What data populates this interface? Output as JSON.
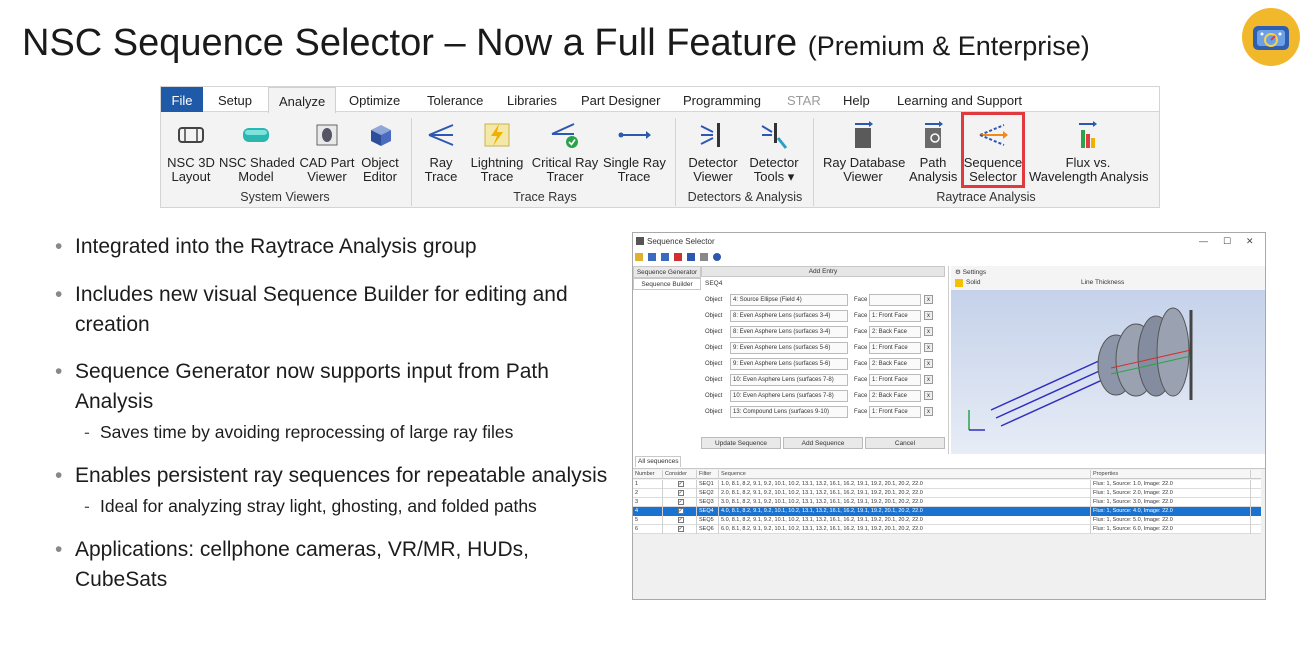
{
  "slide": {
    "title": "NSC Sequence Selector – Now a Full Feature",
    "subtitle": "(Premium & Enterprise)"
  },
  "colors": {
    "file_tab": "#1e5aa8",
    "highlight": "#e0393e",
    "selection": "#1a73d1",
    "logo": "#f2b82c"
  },
  "ribbon": {
    "tabs": [
      "File",
      "Setup",
      "Analyze",
      "Optimize",
      "Tolerance",
      "Libraries",
      "Part Designer",
      "Programming",
      "STAR",
      "Help",
      "Learning and Support"
    ],
    "active_tab": "Analyze",
    "groups": [
      {
        "label": "System Viewers",
        "buttons": [
          {
            "l1": "NSC 3D",
            "l2": "Layout",
            "icon": "nsc-3d-layout-icon"
          },
          {
            "l1": "NSC Shaded",
            "l2": "Model",
            "icon": "shaded-model-icon"
          },
          {
            "l1": "CAD Part",
            "l2": "Viewer",
            "icon": "cad-part-icon"
          },
          {
            "l1": "Object",
            "l2": "Editor",
            "icon": "object-editor-icon"
          }
        ]
      },
      {
        "label": "Trace Rays",
        "buttons": [
          {
            "l1": "Ray",
            "l2": "Trace",
            "icon": "ray-trace-icon"
          },
          {
            "l1": "Lightning",
            "l2": "Trace",
            "icon": "lightning-icon"
          },
          {
            "l1": "Critical Ray",
            "l2": "Tracer",
            "icon": "critical-ray-icon"
          },
          {
            "l1": "Single Ray",
            "l2": "Trace",
            "icon": "single-ray-icon"
          }
        ]
      },
      {
        "label": "Detectors & Analysis",
        "buttons": [
          {
            "l1": "Detector",
            "l2": "Viewer",
            "icon": "detector-viewer-icon"
          },
          {
            "l1": "Detector",
            "l2": "Tools ▾",
            "icon": "detector-tools-icon"
          }
        ]
      },
      {
        "label": "Raytrace Analysis",
        "buttons": [
          {
            "l1": "Ray Database",
            "l2": "Viewer",
            "icon": "ray-database-icon"
          },
          {
            "l1": "Path",
            "l2": "Analysis",
            "icon": "path-analysis-icon"
          },
          {
            "l1": "Sequence",
            "l2": "Selector",
            "icon": "sequence-selector-icon"
          },
          {
            "l1": "Flux vs.",
            "l2": "Wavelength Analysis",
            "icon": "flux-wavelength-icon"
          }
        ]
      }
    ]
  },
  "bullets": [
    {
      "text": "Integrated into the Raytrace Analysis group"
    },
    {
      "text": "Includes new visual Sequence Builder for editing and creation"
    },
    {
      "text": "Sequence Generator now supports input from Path Analysis",
      "sub": "Saves time by avoiding reprocessing of large ray files"
    },
    {
      "text": "Enables persistent ray sequences for repeatable analysis",
      "sub": "Ideal for analyzing stray light, ghosting, and folded paths"
    },
    {
      "text": "Applications: cellphone cameras, VR/MR, HUDs, CubeSats"
    }
  ],
  "window": {
    "title": "Sequence Selector",
    "side_tabs": [
      "Sequence Generator",
      "Sequence Builder"
    ],
    "add_entry": "Add Entry",
    "seq_name": "SEQ4",
    "object_label": "Object",
    "face_label": "Face",
    "builder_rows": [
      {
        "object": "4: Source Ellipse (Field 4)",
        "face": ""
      },
      {
        "object": "8: Even Asphere Lens (surfaces 3-4)",
        "face": "1: Front Face"
      },
      {
        "object": "8: Even Asphere Lens (surfaces 3-4)",
        "face": "2: Back Face"
      },
      {
        "object": "9: Even Asphere Lens (surfaces 5-6)",
        "face": "1: Front Face"
      },
      {
        "object": "9: Even Asphere Lens (surfaces 5-6)",
        "face": "2: Back Face"
      },
      {
        "object": "10: Even Asphere Lens (surfaces 7-8)",
        "face": "1: Front Face"
      },
      {
        "object": "10: Even Asphere Lens (surfaces 7-8)",
        "face": "2: Back Face"
      },
      {
        "object": "13: Compound Lens (surfaces 9-10)",
        "face": "1: Front Face"
      }
    ],
    "buttons": [
      "Update Sequence",
      "Add Sequence",
      "Cancel"
    ],
    "view_toolbar": {
      "settings": "Settings",
      "solid": "Solid",
      "line_thickness": "Line Thickness"
    },
    "all_sequences_tab": "All sequences",
    "columns": [
      "Number",
      "Consider",
      "Filter",
      "Sequence",
      "Properties"
    ],
    "rows": [
      {
        "n": "1",
        "filter": "SEQ1",
        "seq": "1.0, 8.1, 8.2, 9.1, 9.2, 10.1, 10.2, 13.1, 13.2, 16.1, 16.2, 19.1, 19.2, 20.1, 20.2, 22.0",
        "props": "Flux: 1, Source: 1.0, Image: 22.0"
      },
      {
        "n": "2",
        "filter": "SEQ2",
        "seq": "2.0, 8.1, 8.2, 9.1, 9.2, 10.1, 10.2, 13.1, 13.2, 16.1, 16.2, 19.1, 19.2, 20.1, 20.2, 22.0",
        "props": "Flux: 1, Source: 2.0, Image: 22.0"
      },
      {
        "n": "3",
        "filter": "SEQ3",
        "seq": "3.0, 8.1, 8.2, 9.1, 9.2, 10.1, 10.2, 13.1, 13.2, 16.1, 16.2, 19.1, 19.2, 20.1, 20.2, 22.0",
        "props": "Flux: 1, Source: 3.0, Image: 22.0"
      },
      {
        "n": "4",
        "filter": "SEQ4",
        "seq": "4.0, 8.1, 8.2, 9.1, 9.2, 10.1, 10.2, 13.1, 13.2, 16.1, 16.2, 19.1, 19.2, 20.1, 20.2, 22.0",
        "props": "Flux: 1, Source: 4.0, Image: 22.0"
      },
      {
        "n": "5",
        "filter": "SEQ5",
        "seq": "5.0, 8.1, 8.2, 9.1, 9.2, 10.1, 10.2, 13.1, 13.2, 16.1, 16.2, 19.1, 19.2, 20.1, 20.2, 22.0",
        "props": "Flux: 1, Source: 5.0, Image: 22.0"
      },
      {
        "n": "6",
        "filter": "SEQ6",
        "seq": "6.0, 8.1, 8.2, 9.1, 9.2, 10.1, 10.2, 13.1, 13.2, 16.1, 16.2, 19.1, 19.2, 20.1, 20.2, 22.0",
        "props": "Flux: 1, Source: 6.0, Image: 22.0"
      }
    ],
    "selected_row": "4"
  }
}
